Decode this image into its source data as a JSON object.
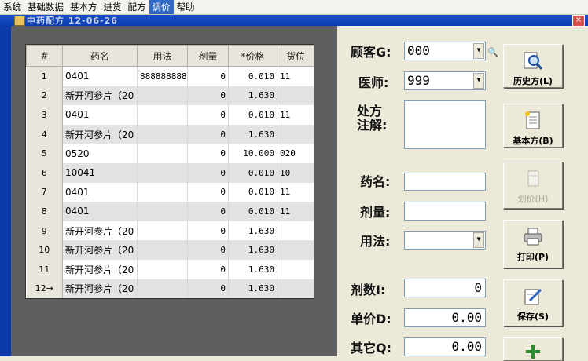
{
  "menu": [
    "系统",
    "基础数据",
    "基本方",
    "进货",
    "配方",
    "调价",
    "帮助"
  ],
  "menu_active_index": 5,
  "window": {
    "title": "中药配方 12-06-26",
    "close_label": "×"
  },
  "grid": {
    "headers": [
      "#",
      "药名",
      "用法",
      "剂量",
      "*价格",
      "货位"
    ],
    "rows": [
      {
        "no": "1",
        "name": "0401",
        "usage": "888888888",
        "dose": "0",
        "price": "0.010",
        "loc": "11"
      },
      {
        "no": "2",
        "name": "新开河参片（20",
        "usage": "",
        "dose": "0",
        "price": "1.630",
        "loc": ""
      },
      {
        "no": "3",
        "name": "0401",
        "usage": "",
        "dose": "0",
        "price": "0.010",
        "loc": "11"
      },
      {
        "no": "4",
        "name": "新开河参片（20",
        "usage": "",
        "dose": "0",
        "price": "1.630",
        "loc": ""
      },
      {
        "no": "5",
        "name": "0520",
        "usage": "",
        "dose": "0",
        "price": "10.000",
        "loc": "020"
      },
      {
        "no": "6",
        "name": "10041",
        "usage": "",
        "dose": "0",
        "price": "0.010",
        "loc": "10"
      },
      {
        "no": "7",
        "name": "0401",
        "usage": "",
        "dose": "0",
        "price": "0.010",
        "loc": "11"
      },
      {
        "no": "8",
        "name": "0401",
        "usage": "",
        "dose": "0",
        "price": "0.010",
        "loc": "11"
      },
      {
        "no": "9",
        "name": "新开河参片（20",
        "usage": "",
        "dose": "0",
        "price": "1.630",
        "loc": ""
      },
      {
        "no": "10",
        "name": "新开河参片（20",
        "usage": "",
        "dose": "0",
        "price": "1.630",
        "loc": ""
      },
      {
        "no": "11",
        "name": "新开河参片（20",
        "usage": "",
        "dose": "0",
        "price": "1.630",
        "loc": ""
      },
      {
        "no": "12→",
        "name": "新开河参片（20",
        "usage": "",
        "dose": "0",
        "price": "1.630",
        "loc": ""
      }
    ]
  },
  "form": {
    "customer_label": "顾客G:",
    "customer_value": "000",
    "doctor_label": "医师:",
    "doctor_value": "999",
    "note_label_1": "处方",
    "note_label_2": "注解:",
    "note_value": "",
    "drug_label": "药名:",
    "drug_value": "",
    "dose_label": "剂量:",
    "dose_value": "",
    "usage_label": "用法:",
    "usage_value": "",
    "count_label": "剂数I:",
    "count_value": "0",
    "unit_price_label": "单价D:",
    "unit_price_value": "0.00",
    "other_label": "其它Q:",
    "other_value": "0.00"
  },
  "buttons": {
    "history": "历史方(L)",
    "basic": "基本方(B)",
    "divide": "划价(H)",
    "print": "打印(P)",
    "save": "保存(S)"
  }
}
